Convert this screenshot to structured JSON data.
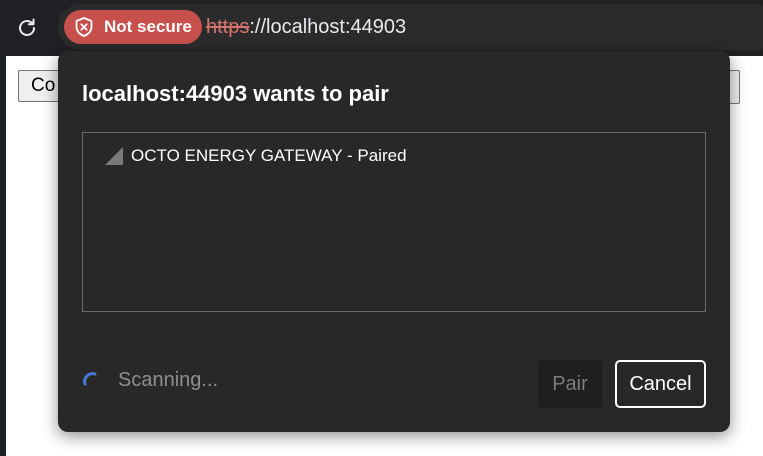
{
  "browser": {
    "security_chip": {
      "label": "Not secure",
      "icon": "shield-x-icon",
      "color": "#c7504c"
    },
    "url": {
      "scheme": "https",
      "rest": "://localhost:44903"
    },
    "reload_icon": "reload-icon"
  },
  "page": {
    "left_button_label": "Co"
  },
  "dialog": {
    "title": "localhost:44903 wants to pair",
    "devices": [
      {
        "label": "OCTO ENERGY GATEWAY - Paired",
        "icon": "signal-strength-icon"
      }
    ],
    "status": {
      "text": "Scanning...",
      "icon": "spinner-icon"
    },
    "buttons": {
      "pair_label": "Pair",
      "pair_disabled": true,
      "cancel_label": "Cancel"
    }
  }
}
